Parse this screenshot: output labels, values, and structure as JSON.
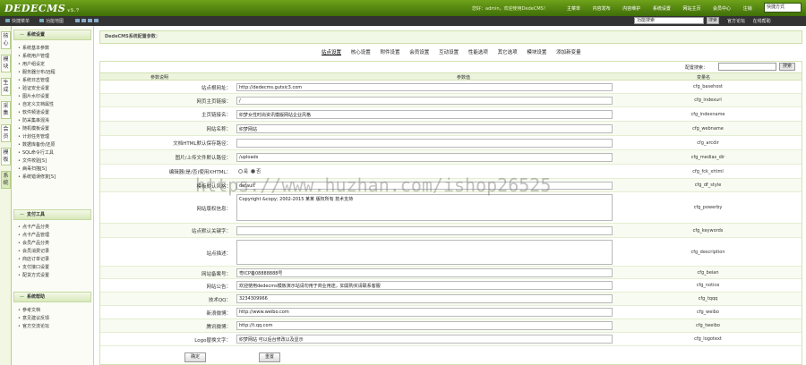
{
  "logo": {
    "text": "DEDECMS",
    "version": "v5.7"
  },
  "header": {
    "user_text": "您好：admin，欢迎使用DedeCMS！",
    "nav": [
      "主菜单",
      "内容发布",
      "内容维护",
      "系统设置",
      "网站主页",
      "会员中心",
      "注销"
    ],
    "mode": "快捷方式"
  },
  "subbar": {
    "links": [
      "快捷菜单",
      "功能地图"
    ],
    "search_value": "功能搜索",
    "search_button": "搜索",
    "right_links": [
      "官方论坛",
      "在线帮助"
    ]
  },
  "vtabs": [
    "核心",
    "模块",
    "生成",
    "采集",
    "会员",
    "模板",
    "系统"
  ],
  "sidebar": {
    "sections": [
      {
        "title": "系统设置",
        "items": [
          "系统基本参数",
          "系统用户管理",
          "用户组设定",
          "服务器分布/远程",
          "系统日志管理",
          "验证安全设置",
          "图片水印设置",
          "自定义文档属性",
          "软件频道设置",
          "防采集串混淆",
          "随机模板设置",
          "计划任务管理",
          "数据库备份/还原",
          "SQL命令行工具",
          "文件校验[S]",
          "病毒扫描[S]",
          "系统错误修复[S]"
        ]
      },
      {
        "title": "支付工具",
        "items": [
          "点卡产品分类",
          "点卡产品管理",
          "会员产品分类",
          "会员消费记录",
          "商店订单记录",
          "支付接口设置",
          "配货方式设置"
        ]
      },
      {
        "title": "系统帮助",
        "items": [
          "参考文档",
          "意见建议反馈",
          "官方交流论坛"
        ]
      }
    ]
  },
  "main": {
    "heading": "DedeCMS系统配置参数：",
    "tabs": [
      "站点设置",
      "核心设置",
      "附件设置",
      "会员设置",
      "互动设置",
      "性能选项",
      "其它选项",
      "模块设置",
      "添加新变量"
    ],
    "config_search_label": "配置搜索：",
    "config_search_button": "搜索",
    "columns": [
      "参数说明",
      "参数值",
      "变量名"
    ],
    "rows": [
      {
        "label": "站点根网址：",
        "value": "http://dedecms.gutsic3.com",
        "var": "cfg_basehost"
      },
      {
        "label": "网页主页链接：",
        "value": "/",
        "var": "cfg_indexurl"
      },
      {
        "label": "主页链接名：",
        "value": "织梦女性时尚资讯模版网站企业风格",
        "var": "cfg_indexname"
      },
      {
        "label": "网站名称：",
        "value": "织梦网站",
        "var": "cfg_webname"
      },
      {
        "label": "文档HTML默认保存路径：",
        "value": "",
        "var": "cfg_arcdir"
      },
      {
        "label": "图片/上传文件默认路径：",
        "value": "/uploads",
        "var": "cfg_medias_dir"
      },
      {
        "label": "编辑器(是/否)使用XHTML：",
        "value": "",
        "var": "cfg_fck_xhtml",
        "radio": [
          "是",
          "否"
        ]
      },
      {
        "label": "模板默认风格：",
        "value": "default",
        "var": "cfg_df_style"
      },
      {
        "label": "网站版权信息：",
        "value": "Copyright &copy; 2002-2015 某某 版权所有 技术支持",
        "var": "cfg_powerby"
      },
      {
        "label": "站点默认关键字：",
        "value": "",
        "var": "cfg_keywords"
      },
      {
        "label": "站点描述：",
        "value": "",
        "var": "cfg_description"
      },
      {
        "label": "网站备案号：",
        "value": "粤ICP备08888888号",
        "var": "cfg_beian"
      },
      {
        "label": "网站公告：",
        "value": "欢迎使用dedecms模板演示站请勿用于商业用途，如需购买请联系客服",
        "var": "cfg_notice"
      },
      {
        "label": "技术QQ：",
        "value": "3234309966",
        "var": "cfg_tqqq"
      },
      {
        "label": "新浪微博：",
        "value": "http://www.weibo.com",
        "var": "cfg_weibo"
      },
      {
        "label": "腾讯微博：",
        "value": "http://t.qq.com",
        "var": "cfg_tweibo"
      },
      {
        "label": "Logo替换文字：",
        "value": "织梦网站 可以后台修改以及显示",
        "var": "cfg_logotext"
      }
    ],
    "confirm_button": "确定",
    "reset_button": "重置"
  },
  "watermark": "https://www.huzhan.com/ishop26525"
}
